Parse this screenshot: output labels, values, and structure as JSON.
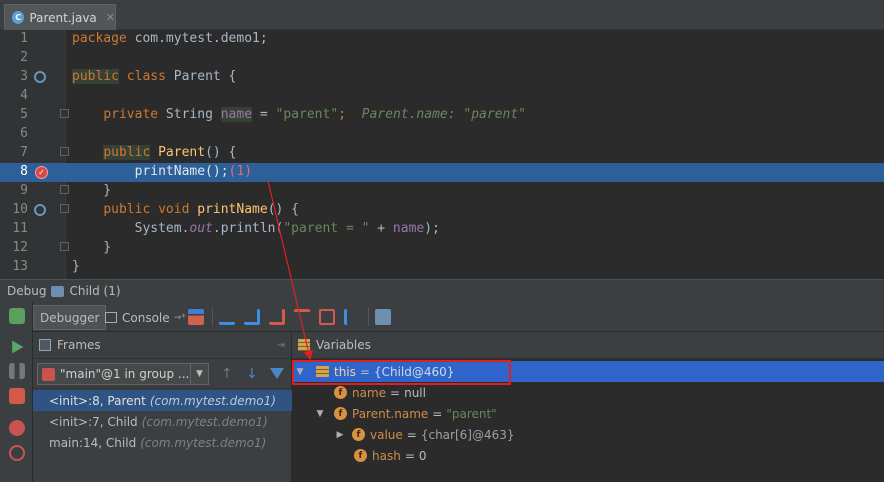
{
  "tab": {
    "icon": "C",
    "label": "Parent.java",
    "close": "✕"
  },
  "editor": {
    "lines": [
      {
        "n": "1",
        "segs": [
          {
            "t": "package",
            "c": "kw"
          },
          {
            "t": " com.mytest.demo1;",
            "c": ""
          }
        ]
      },
      {
        "n": "2",
        "segs": []
      },
      {
        "n": "3",
        "segs": [
          {
            "t": "public",
            "c": "kw hl-box"
          },
          {
            "t": " ",
            "c": ""
          },
          {
            "t": "class",
            "c": "kw"
          },
          {
            "t": " Parent {",
            "c": ""
          }
        ]
      },
      {
        "n": "4",
        "segs": []
      },
      {
        "n": "5",
        "segs": [
          {
            "t": "    ",
            "c": ""
          },
          {
            "t": "private",
            "c": "kw"
          },
          {
            "t": " String ",
            "c": ""
          },
          {
            "t": "name",
            "c": "fld hl-box"
          },
          {
            "t": " = ",
            "c": ""
          },
          {
            "t": "\"parent\"",
            "c": "str"
          },
          {
            "t": ";  ",
            "c": "kw"
          },
          {
            "t": "Parent.name: \"parent\"",
            "c": "hint"
          }
        ]
      },
      {
        "n": "6",
        "segs": []
      },
      {
        "n": "7",
        "segs": [
          {
            "t": "    ",
            "c": ""
          },
          {
            "t": "public",
            "c": "kw hl-box"
          },
          {
            "t": " ",
            "c": ""
          },
          {
            "t": "Parent",
            "c": "fn"
          },
          {
            "t": "() {",
            "c": ""
          }
        ]
      },
      {
        "n": "8",
        "current": true,
        "segs": [
          {
            "t": "        printName();",
            "c": ""
          },
          {
            "t": "(1)",
            "c": "bp-marker"
          }
        ]
      },
      {
        "n": "9",
        "segs": [
          {
            "t": "    }",
            "c": ""
          }
        ]
      },
      {
        "n": "10",
        "segs": [
          {
            "t": "    ",
            "c": ""
          },
          {
            "t": "public",
            "c": "kw"
          },
          {
            "t": " ",
            "c": ""
          },
          {
            "t": "void",
            "c": "kw"
          },
          {
            "t": " ",
            "c": ""
          },
          {
            "t": "printName",
            "c": "fn"
          },
          {
            "t": "() {",
            "c": ""
          }
        ]
      },
      {
        "n": "11",
        "segs": [
          {
            "t": "        System.",
            "c": ""
          },
          {
            "t": "out",
            "c": "fld it"
          },
          {
            "t": ".println(",
            "c": ""
          },
          {
            "t": "\"parent = \"",
            "c": "str"
          },
          {
            "t": " + ",
            "c": ""
          },
          {
            "t": "name",
            "c": "fld"
          },
          {
            "t": ");",
            "c": ""
          }
        ]
      },
      {
        "n": "12",
        "segs": [
          {
            "t": "    }",
            "c": ""
          }
        ]
      },
      {
        "n": "13",
        "segs": [
          {
            "t": "}",
            "c": ""
          }
        ]
      }
    ]
  },
  "debug": {
    "title": "Debug",
    "session": "Child (1)",
    "tabs": {
      "debugger": "Debugger",
      "console": "Console",
      "console_suffix": "→*"
    }
  },
  "frames": {
    "title": "Frames",
    "thread": "\"main\"@1 in group ...",
    "items": [
      {
        "method": "<init>:8, Parent",
        "pkg": "(com.mytest.demo1)",
        "selected": true
      },
      {
        "method": "<init>:7, Child",
        "pkg": "(com.mytest.demo1)",
        "selected": false
      },
      {
        "method": "main:14, Child",
        "pkg": "(com.mytest.demo1)",
        "selected": false
      }
    ]
  },
  "variables": {
    "title": "Variables",
    "rows": [
      {
        "name": "this",
        "value": "{Child@460}"
      },
      {
        "name": "name",
        "value": "null"
      },
      {
        "name": "Parent.name",
        "value": "\"parent\""
      },
      {
        "name": "value",
        "value": "{char[6]@463}"
      },
      {
        "name": "hash",
        "value": "0"
      }
    ]
  },
  "colors": {
    "current_line": "#2d6099",
    "selected_var": "#2f65ca",
    "highlight_box": "#e02020",
    "breakpoint": "#d94848"
  }
}
